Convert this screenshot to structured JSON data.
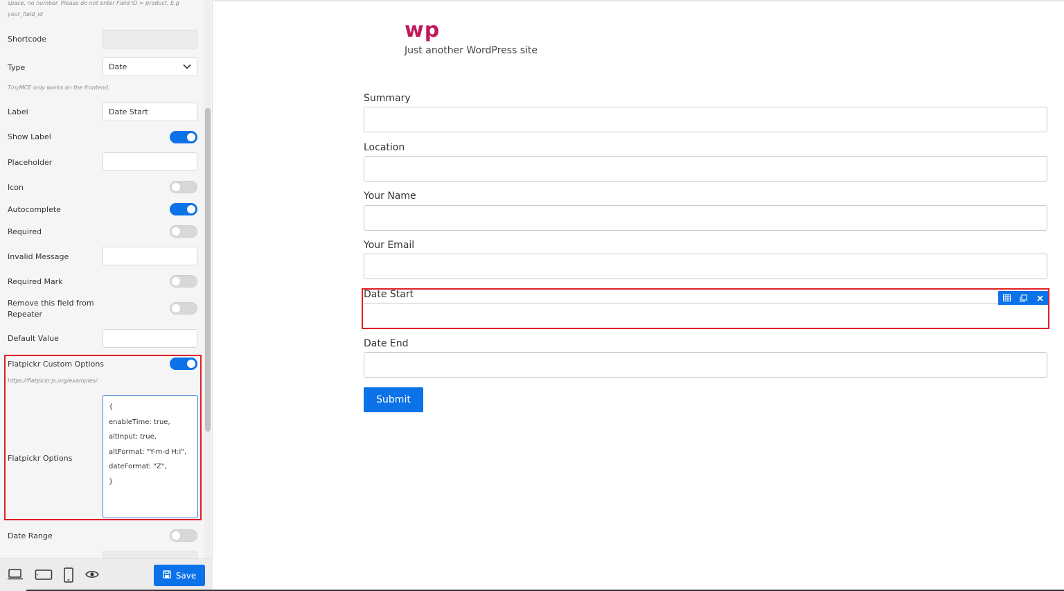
{
  "sidebar": {
    "help_top_line1": "space, no number. Please do not enter Field ID = product. E.g",
    "help_top_line2": "your_field_id",
    "shortcode_label": "Shortcode",
    "shortcode_value": "",
    "type_label": "Type",
    "type_value": "Date",
    "tinymce_help": "TinyMCE only works on the frontend.",
    "label_label": "Label",
    "label_value": "Date Start",
    "show_label_label": "Show Label",
    "placeholder_label": "Placeholder",
    "placeholder_value": "",
    "icon_label": "Icon",
    "autocomplete_label": "Autocomplete",
    "required_label": "Required",
    "invalid_message_label": "Invalid Message",
    "invalid_message_value": "",
    "required_mark_label": "Required Mark",
    "remove_repeater_line1": "Remove this field from",
    "remove_repeater_line2": "Repeater",
    "default_value_label": "Default Value",
    "default_value_value": "",
    "flatpickr_custom_label": "Flatpickr Custom Options",
    "flatpickr_link": "https://flatpickr.js.org/examples/",
    "flatpickr_options_label": "Flatpickr Options",
    "flatpickr_options_value": "{\nenableTime: true,\naltInput: true,\naltFormat: \"Y-m-d H:i\",\ndateFormat: \"Z\",\n}",
    "date_range_label": "Date Range",
    "toggles": {
      "show_label": true,
      "icon": false,
      "autocomplete": true,
      "required": false,
      "required_mark": false,
      "remove_repeater": false,
      "flatpickr_custom": true,
      "date_range": false
    },
    "footer": {
      "icons": [
        "laptop-icon",
        "tablet-landscape-icon",
        "mobile-icon",
        "eye-icon"
      ],
      "save_label": "Save"
    }
  },
  "site": {
    "title": "wp",
    "tagline": "Just another WordPress site"
  },
  "form": {
    "fields": [
      {
        "label": "Summary",
        "value": ""
      },
      {
        "label": "Location",
        "value": ""
      },
      {
        "label": "Your Name",
        "value": ""
      },
      {
        "label": "Your Email",
        "value": ""
      },
      {
        "label": "Date Start",
        "value": ""
      },
      {
        "label": "Date End",
        "value": ""
      }
    ],
    "submit_label": "Submit",
    "selected_field_toolbar": [
      "grid-icon",
      "duplicate-icon",
      "close-icon"
    ]
  },
  "colors": {
    "accent": "#0b72e8",
    "highlight": "#e01e26",
    "brand": "#c2185b"
  }
}
